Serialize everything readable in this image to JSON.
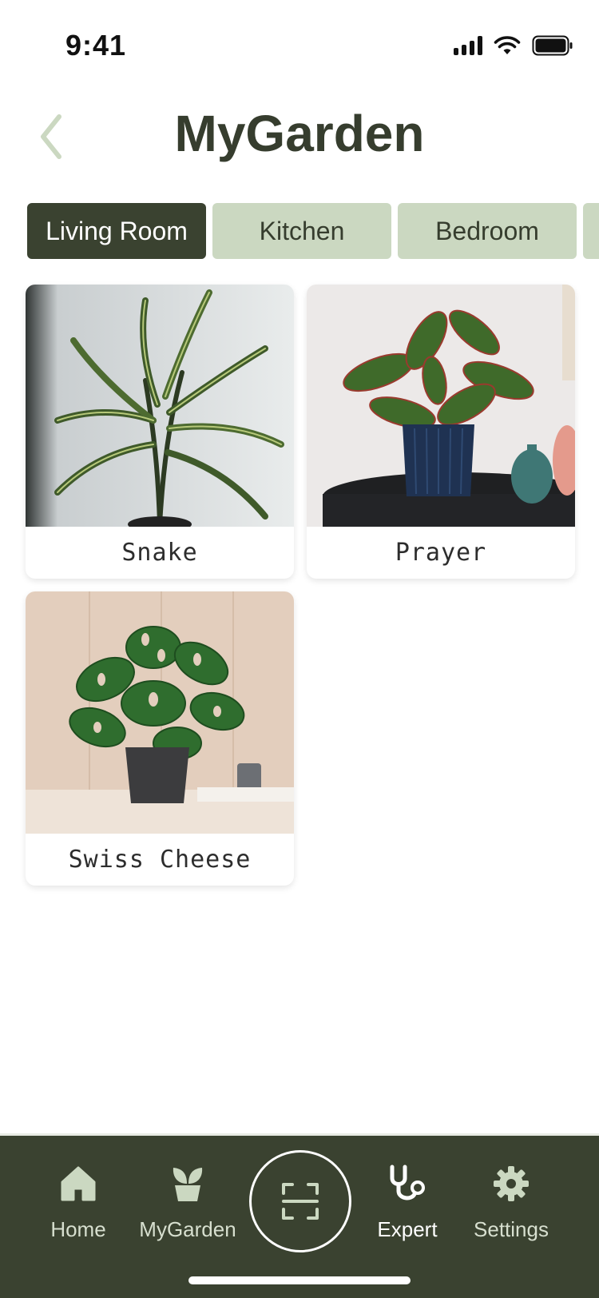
{
  "status": {
    "time": "9:41"
  },
  "header": {
    "title": "MyGarden",
    "back_icon": "chevron-left-icon"
  },
  "tabs": [
    {
      "label": "Living Room",
      "active": true
    },
    {
      "label": "Kitchen",
      "active": false
    },
    {
      "label": "Bedroom",
      "active": false
    }
  ],
  "plants": [
    {
      "name": "Snake"
    },
    {
      "name": "Prayer"
    },
    {
      "name": "Swiss Cheese"
    }
  ],
  "nav": {
    "items": [
      {
        "label": "Home",
        "icon": "home-icon"
      },
      {
        "label": "MyGarden",
        "icon": "plant-icon"
      },
      {
        "label": "Expert",
        "icon": "stethoscope-icon",
        "active": true
      },
      {
        "label": "Settings",
        "icon": "gear-icon"
      }
    ],
    "scan_icon": "scan-icon"
  },
  "colors": {
    "primary": "#3a4230",
    "tab_inactive": "#cbd8c1",
    "nav_label": "#d7dfcf"
  }
}
